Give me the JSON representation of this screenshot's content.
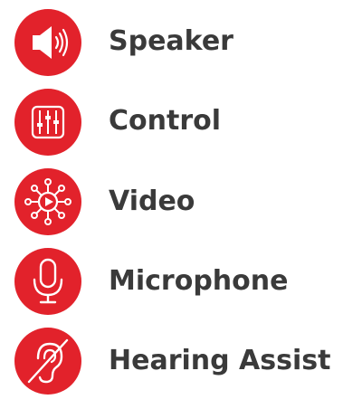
{
  "accent_color": "#e2222b",
  "text_color": "#3a3a3a",
  "items": [
    {
      "label": "Speaker",
      "icon": "speaker-icon"
    },
    {
      "label": "Control",
      "icon": "control-sliders-icon"
    },
    {
      "label": "Video",
      "icon": "video-network-icon"
    },
    {
      "label": "Microphone",
      "icon": "microphone-icon"
    },
    {
      "label": "Hearing Assist",
      "icon": "hearing-assist-icon"
    }
  ]
}
